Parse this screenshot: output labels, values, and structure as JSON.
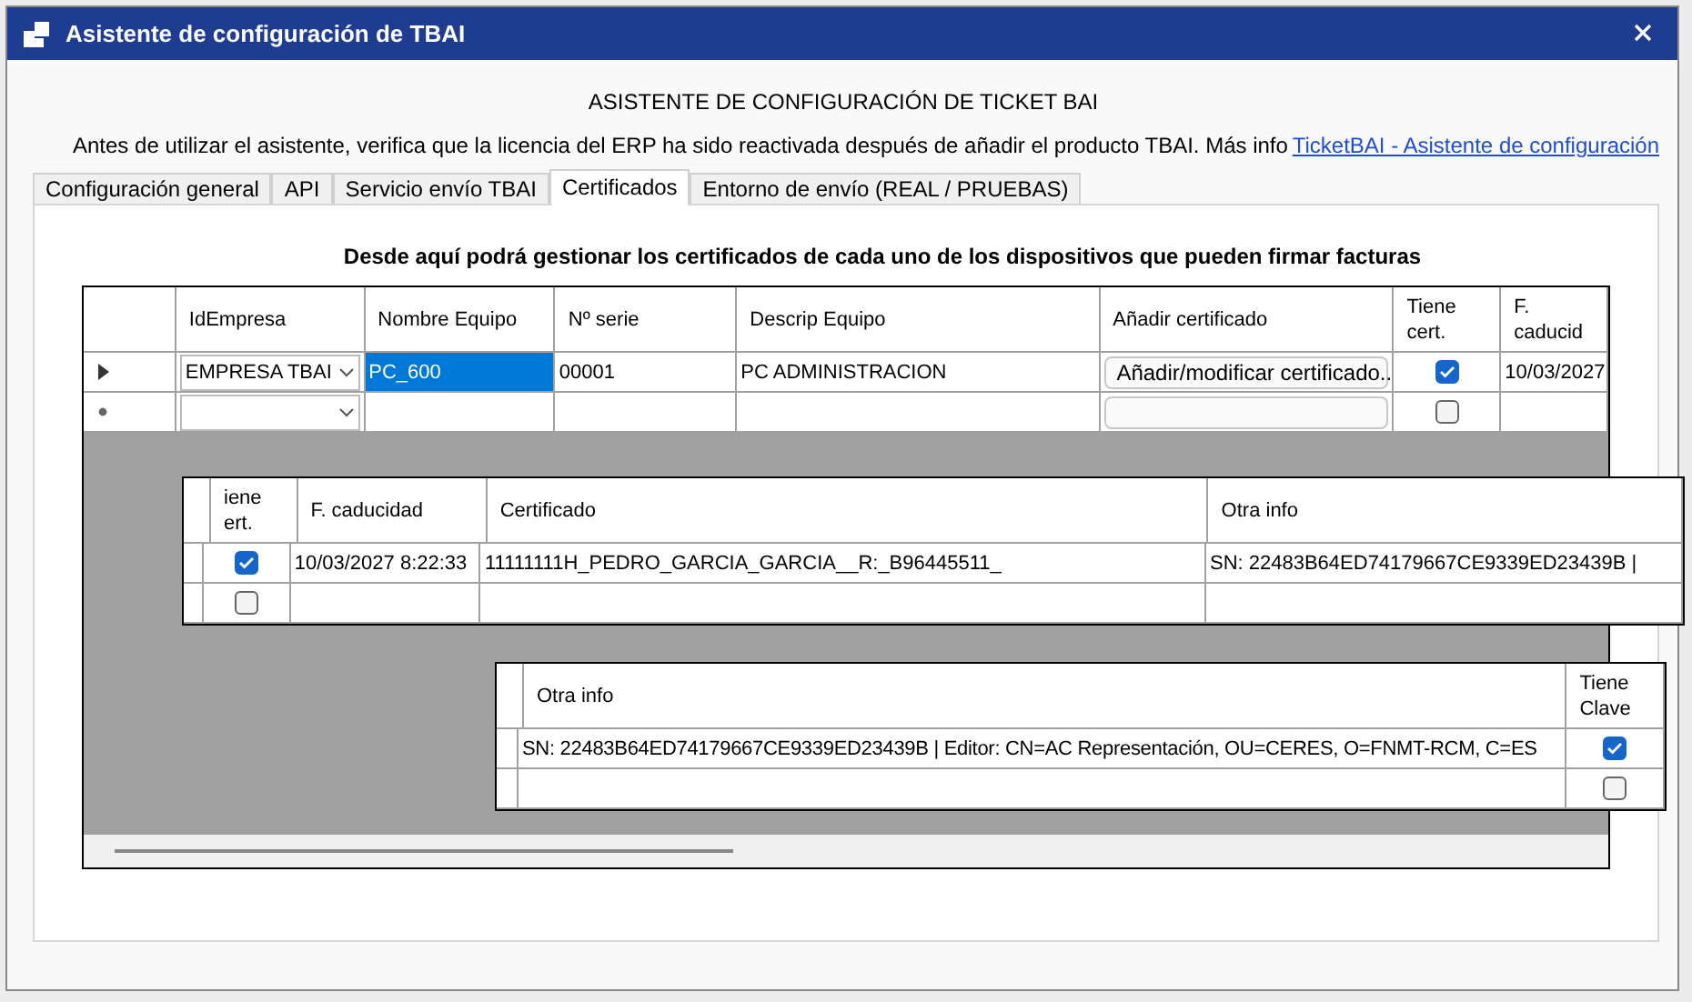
{
  "window": {
    "title": "Asistente de configuración de TBAI"
  },
  "heading": "ASISTENTE DE CONFIGURACIÓN DE TICKET BAI",
  "notice": "Antes de utilizar el asistente, verifica que la licencia del ERP ha sido reactivada después de añadir el producto TBAI. Más info",
  "help_link": "TicketBAI - Asistente de configuración",
  "tabs": [
    {
      "label": "Configuración general",
      "selected": false
    },
    {
      "label": "API",
      "selected": false
    },
    {
      "label": "Servicio envío TBAI",
      "selected": false
    },
    {
      "label": "Certificados",
      "selected": true
    },
    {
      "label": "Entorno de envío (REAL / PRUEBAS)",
      "selected": false
    }
  ],
  "instructions": "Desde aquí podrá gestionar los certificados de cada uno de los dispositivos que pueden firmar facturas",
  "grids": [
    {
      "columns": [
        "IdEmpresa",
        "Nombre Equipo",
        "Nº serie",
        "Descrip Equipo",
        "Añadir certificado",
        "Tiene cert.",
        "F. caducid"
      ],
      "rows": [
        {
          "current": true,
          "cells": [
            {
              "kind": "combo",
              "text": "EMPRESA TBAI"
            },
            {
              "kind": "text",
              "text": "PC_600",
              "selected": true
            },
            {
              "kind": "text",
              "text": "00001",
              "selected": false
            },
            {
              "kind": "text",
              "text": "PC ADMINISTRACION",
              "selected": false
            },
            {
              "kind": "button",
              "text": "Añadir/modificar certificado..."
            },
            {
              "kind": "check",
              "checked": true
            },
            {
              "kind": "text",
              "text": "10/03/2027",
              "selected": false
            }
          ]
        },
        {
          "current": false,
          "cells": [
            {
              "kind": "combo"
            },
            {
              "kind": "text",
              "selected": false
            },
            {
              "kind": "text",
              "selected": false
            },
            {
              "kind": "text",
              "selected": false
            },
            {
              "kind": "button"
            },
            {
              "kind": "check",
              "checked": false
            },
            {
              "kind": "text",
              "selected": false
            }
          ]
        }
      ]
    },
    {
      "columns": [
        "iene ert.",
        "F. caducidad",
        "Certificado",
        "Otra info"
      ],
      "rows": [
        {
          "cells": [
            {
              "kind": "check",
              "checked": true
            },
            {
              "kind": "text",
              "text": "10/03/2027 8:22:33",
              "selected": false
            },
            {
              "kind": "text",
              "text": "11111111H_PEDRO_GARCIA_GARCIA__R:_B96445511_",
              "selected": false
            },
            {
              "kind": "text",
              "text": "SN: 22483B64ED74179667CE9339ED23439B |",
              "selected": false
            }
          ]
        },
        {
          "cells": [
            {
              "kind": "check",
              "checked": false
            },
            {
              "kind": "text",
              "selected": false
            },
            {
              "kind": "text",
              "selected": false
            },
            {
              "kind": "text",
              "selected": false
            }
          ]
        }
      ]
    },
    {
      "columns": [
        "Otra info",
        "Tiene Clave"
      ],
      "rows": [
        {
          "cells": [
            {
              "kind": "text",
              "text": "SN: 22483B64ED74179667CE9339ED23439B | Editor: CN=AC Representación, OU=CERES, O=FNMT-RCM, C=ES",
              "selected": false
            },
            {
              "kind": "check",
              "checked": true
            }
          ]
        },
        {
          "cells": [
            {
              "kind": "text",
              "selected": false
            },
            {
              "kind": "check",
              "checked": false
            }
          ]
        }
      ]
    }
  ]
}
